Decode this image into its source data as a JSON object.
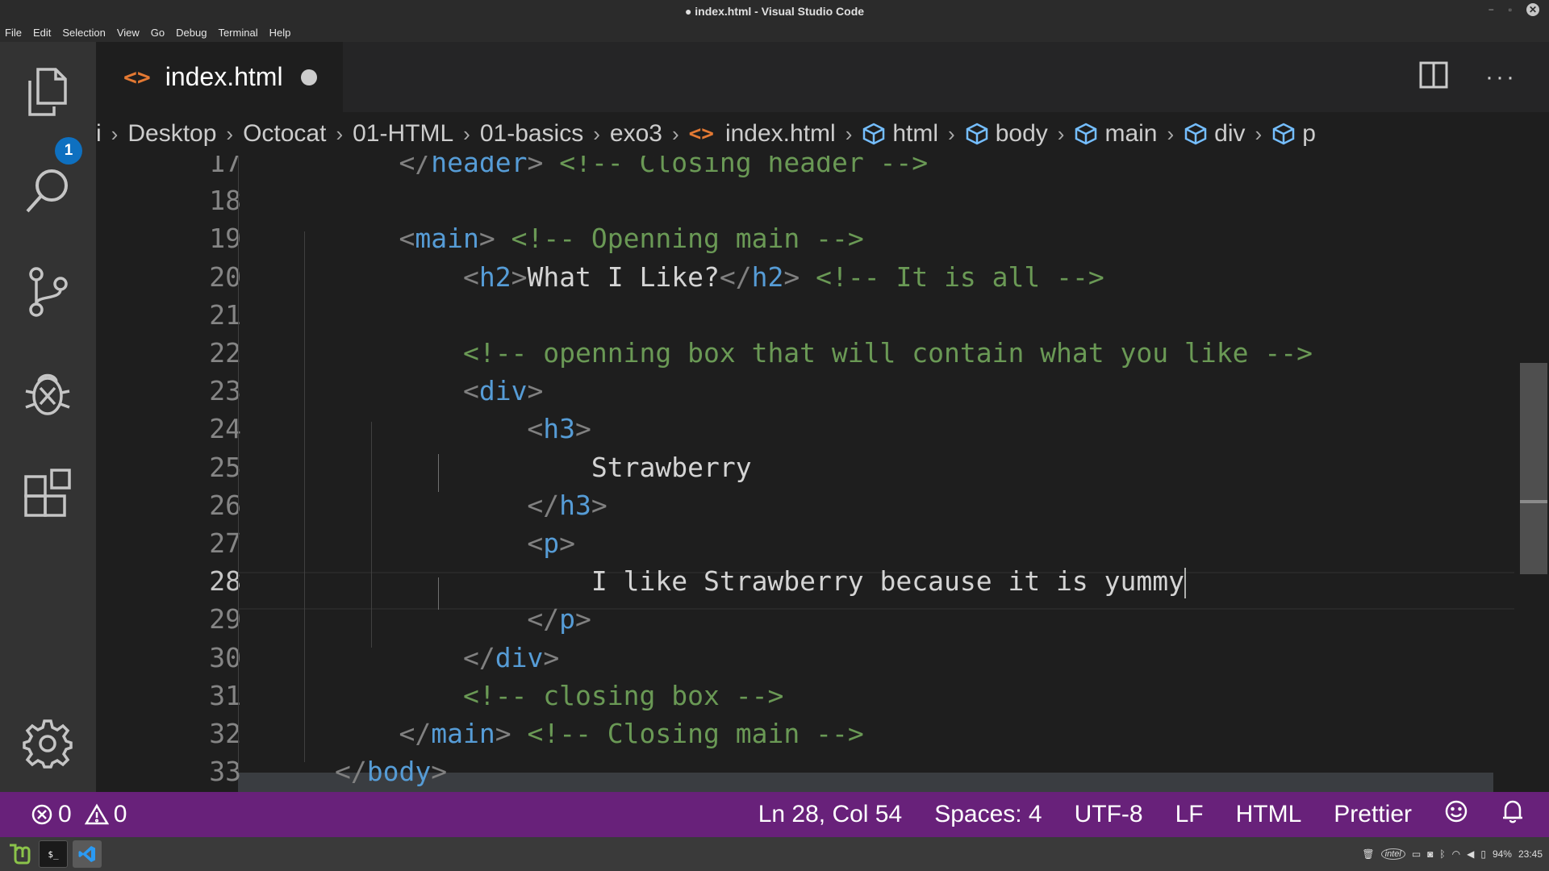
{
  "window": {
    "title": "● index.html - Visual Studio Code",
    "minimize": "−",
    "restore": "▫",
    "close": "✕"
  },
  "menu": [
    "File",
    "Edit",
    "Selection",
    "View",
    "Go",
    "Debug",
    "Terminal",
    "Help"
  ],
  "activity": {
    "explorer_badge": "1"
  },
  "tab": {
    "icon": "<>",
    "label": "index.html"
  },
  "tab_actions": {
    "more": "···"
  },
  "breadcrumb": {
    "folders": [
      "i",
      "Desktop",
      "Octocat",
      "01-HTML",
      "01-basics",
      "exo3"
    ],
    "file_icon": "<>",
    "file": "index.html",
    "symbols": [
      "html",
      "body",
      "main",
      "div",
      "p"
    ]
  },
  "editor": {
    "active_line": "28",
    "lines": [
      {
        "n": "17",
        "indent": "    ",
        "tokens": [
          [
            "p",
            "</"
          ],
          [
            "t",
            "header"
          ],
          [
            "p",
            ">"
          ],
          [
            "x",
            " "
          ],
          [
            "c",
            "<!-- Closing header -->"
          ]
        ]
      },
      {
        "n": "18",
        "indent": "",
        "tokens": []
      },
      {
        "n": "19",
        "indent": "    ",
        "tokens": [
          [
            "p",
            "<"
          ],
          [
            "t",
            "main"
          ],
          [
            "p",
            ">"
          ],
          [
            "x",
            " "
          ],
          [
            "c",
            "<!-- Openning main -->"
          ]
        ]
      },
      {
        "n": "20",
        "indent": "        ",
        "tokens": [
          [
            "p",
            "<"
          ],
          [
            "t",
            "h2"
          ],
          [
            "p",
            ">"
          ],
          [
            "x",
            "What I Like?"
          ],
          [
            "p",
            "</"
          ],
          [
            "t",
            "h2"
          ],
          [
            "p",
            ">"
          ],
          [
            "x",
            " "
          ],
          [
            "c",
            "<!-- It is all -->"
          ]
        ]
      },
      {
        "n": "21",
        "indent": "",
        "tokens": []
      },
      {
        "n": "22",
        "indent": "        ",
        "tokens": [
          [
            "c",
            "<!-- openning box that will contain what you like -->"
          ]
        ]
      },
      {
        "n": "23",
        "indent": "        ",
        "tokens": [
          [
            "p",
            "<"
          ],
          [
            "t",
            "div"
          ],
          [
            "p",
            ">"
          ]
        ]
      },
      {
        "n": "24",
        "indent": "            ",
        "tokens": [
          [
            "p",
            "<"
          ],
          [
            "t",
            "h3"
          ],
          [
            "p",
            ">"
          ]
        ]
      },
      {
        "n": "25",
        "indent": "                ",
        "tokens": [
          [
            "x",
            "Strawberry"
          ]
        ]
      },
      {
        "n": "26",
        "indent": "            ",
        "tokens": [
          [
            "p",
            "</"
          ],
          [
            "t",
            "h3"
          ],
          [
            "p",
            ">"
          ]
        ]
      },
      {
        "n": "27",
        "indent": "            ",
        "tokens": [
          [
            "p",
            "<"
          ],
          [
            "t",
            "p"
          ],
          [
            "p",
            ">"
          ]
        ]
      },
      {
        "n": "28",
        "indent": "                ",
        "tokens": [
          [
            "x",
            "I like Strawberry because it is yummy"
          ]
        ]
      },
      {
        "n": "29",
        "indent": "            ",
        "tokens": [
          [
            "p",
            "</"
          ],
          [
            "t",
            "p"
          ],
          [
            "p",
            ">"
          ]
        ]
      },
      {
        "n": "30",
        "indent": "        ",
        "tokens": [
          [
            "p",
            "</"
          ],
          [
            "t",
            "div"
          ],
          [
            "p",
            ">"
          ]
        ]
      },
      {
        "n": "31",
        "indent": "        ",
        "tokens": [
          [
            "c",
            "<!-- closing box -->"
          ]
        ]
      },
      {
        "n": "32",
        "indent": "    ",
        "tokens": [
          [
            "p",
            "</"
          ],
          [
            "t",
            "main"
          ],
          [
            "p",
            ">"
          ],
          [
            "x",
            " "
          ],
          [
            "c",
            "<!-- Closing main -->"
          ]
        ]
      },
      {
        "n": "33",
        "indent": "",
        "tokens": [
          [
            "p",
            "</"
          ],
          [
            "t",
            "body"
          ],
          [
            "p",
            ">"
          ]
        ]
      }
    ]
  },
  "status": {
    "errors": "0",
    "warnings": "0",
    "position": "Ln 28, Col 54",
    "spaces": "Spaces: 4",
    "encoding": "UTF-8",
    "eol": "LF",
    "language": "HTML",
    "formatter": "Prettier"
  },
  "taskbar": {
    "terminal_glyph": "$_",
    "tray_intel": "intel",
    "battery": "94%",
    "clock": "23:45"
  },
  "colors": {
    "statusbar": "#68217a",
    "accent_badge": "#0e70c0",
    "html_icon": "#e37933",
    "tag": "#569cd6",
    "comment": "#6a9955"
  }
}
